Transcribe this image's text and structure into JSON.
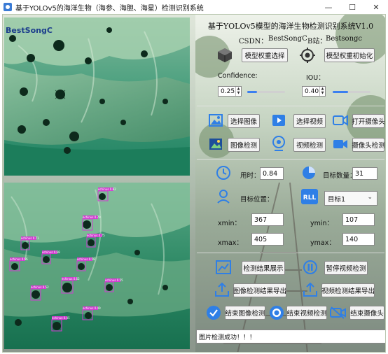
{
  "window": {
    "title": "基于YOLOv5的海洋生物（海参、海胆、海星）检测识别系统",
    "controls": {
      "minimize": "—",
      "maximize": "☐",
      "close": "✕"
    }
  },
  "images": {
    "watermark": "BestSongC",
    "detections": [
      "echinus 0.82",
      "echinus 0.79",
      "echinus 0.75",
      "echinus 0.71",
      "echinus 0.68",
      "echinus 0.66",
      "echinus 0.62",
      "echinus 0.58",
      "echinus 0.55",
      "echinus 0.52",
      "echinus 0.49",
      "echinus 0.45"
    ]
  },
  "header": {
    "title": "基于YOLOv5模型的海洋生物检测识别系统V1.0",
    "csdn_label": "CSDN：",
    "csdn_value": "BestSongC",
    "bili_label": "B站：",
    "bili_value": "Bestsongc"
  },
  "model": {
    "select_weights": "模型权重选择",
    "init_weights": "模型权重初始化"
  },
  "params": {
    "confidence_label": "Confidence:",
    "confidence_value": "0.25",
    "confidence_fraction": 0.25,
    "iou_label": "IOU：",
    "iou_value": "0.40",
    "iou_fraction": 0.4
  },
  "media": {
    "select_image": "选择图像",
    "select_video": "选择视频",
    "open_camera": "打开摄像头",
    "image_detect": "图像检测",
    "video_detect": "视频检测",
    "camera_detect": "摄像头检测"
  },
  "results": {
    "time_label": "用时：",
    "time_value": "0.84",
    "count_label": "目标数量：",
    "count_value": "31",
    "pos_label": "目标位置：",
    "target_select": "目标1",
    "xmin_label": "xmin：",
    "xmin_value": "367",
    "ymin_label": "ymin：",
    "ymin_value": "107",
    "xmax_label": "xmax：",
    "xmax_value": "405",
    "ymax_label": "ymax：",
    "ymax_value": "140"
  },
  "actions": {
    "show_results": "检测结果展示",
    "pause_video": "暂停视频检测",
    "export_image": "图像检测结果导出",
    "export_video": "视频检测结果导出",
    "end_image": "结束图像检测",
    "end_video": "结束视频检测",
    "end_camera": "结束摄像头"
  },
  "status": {
    "message": "图片检测成功！！！"
  },
  "colors": {
    "accent_blue": "#2f7fe6",
    "box_color": "#d03cd0",
    "water_green": "#1f7a55"
  }
}
